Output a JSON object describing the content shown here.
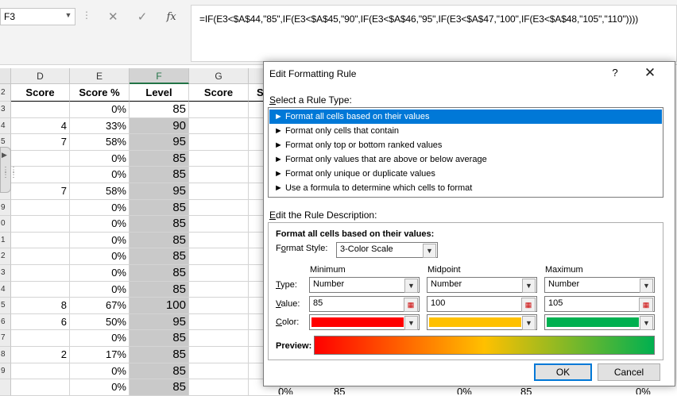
{
  "formula_bar": {
    "name_box": "F3",
    "cancel_glyph": "✕",
    "enter_glyph": "✓",
    "fx_label": "fx",
    "formula": "=IF(E3<$A$44,\"85\",IF(E3<$A$45,\"90\",IF(E3<$A$46,\"95\",IF(E3<$A$47,\"100\",IF(E3<$A$48,\"105\",\"110\"))))"
  },
  "sheet": {
    "columns": [
      "D",
      "E",
      "F",
      "G"
    ],
    "column_overflow": "",
    "selected_column": "F",
    "header_row_num": "2",
    "headers": {
      "D": "Score",
      "E": "Score %",
      "F": "Level",
      "G": "Score",
      "H": "S"
    },
    "row_numbers": [
      "3",
      "4",
      "5",
      "6",
      "7",
      "8",
      "9",
      "0",
      "1",
      "2",
      "3",
      "4",
      "5",
      "6",
      "7",
      "8",
      "9",
      ""
    ],
    "rows": [
      {
        "d": "",
        "e": "0%",
        "f": "85"
      },
      {
        "d": "4",
        "e": "33%",
        "f": "90"
      },
      {
        "d": "7",
        "e": "58%",
        "f": "95"
      },
      {
        "d": "",
        "e": "0%",
        "f": "85"
      },
      {
        "d": "",
        "e": "0%",
        "f": "85"
      },
      {
        "d": "7",
        "e": "58%",
        "f": "95"
      },
      {
        "d": "",
        "e": "0%",
        "f": "85"
      },
      {
        "d": "",
        "e": "0%",
        "f": "85"
      },
      {
        "d": "",
        "e": "0%",
        "f": "85"
      },
      {
        "d": "",
        "e": "0%",
        "f": "85"
      },
      {
        "d": "",
        "e": "0%",
        "f": "85"
      },
      {
        "d": "",
        "e": "0%",
        "f": "85"
      },
      {
        "d": "8",
        "e": "67%",
        "f": "100"
      },
      {
        "d": "6",
        "e": "50%",
        "f": "95"
      },
      {
        "d": "",
        "e": "0%",
        "f": "85"
      },
      {
        "d": "2",
        "e": "17%",
        "f": "85"
      },
      {
        "d": "",
        "e": "0%",
        "f": "85"
      },
      {
        "d": "",
        "e": "0%",
        "f": "85"
      }
    ],
    "below_dialog": [
      "0%",
      "85",
      "0%",
      "85",
      "0%"
    ]
  },
  "dialog": {
    "title": "Edit Formatting Rule",
    "help": "?",
    "close": "✕",
    "select_rule_type_label": "elect a Rule Type:",
    "select_rule_type_key": "S",
    "rule_types": [
      "► Format all cells based on their values",
      "► Format only cells that contain",
      "► Format only top or bottom ranked values",
      "► Format only values that are above or below average",
      "► Format only unique or duplicate values",
      "► Use a formula to determine which cells to format"
    ],
    "selected_rule_index": 0,
    "edit_desc_label": "dit the Rule Description:",
    "edit_desc_key": "E",
    "desc_heading": "Format all cells based on their values:",
    "format_style_label_key": "o",
    "format_style_label_pre": "F",
    "format_style_label_post": "rmat Style:",
    "format_style_value": "3-Color Scale",
    "col_min": "Minimum",
    "col_mid": "Midpoint",
    "col_max": "Maximum",
    "type_label_key": "T",
    "type_label_post": "ype:",
    "value_label_key": "V",
    "value_label_post": "alue:",
    "color_label_key": "C",
    "color_label_post": "olor:",
    "min_type": "Number",
    "mid_type": "Number",
    "max_type": "Number",
    "min_value": "85",
    "mid_value": "100",
    "max_value": "105",
    "min_color": "#ff0000",
    "mid_color": "#ffc000",
    "max_color": "#00b050",
    "preview_label": "Preview:",
    "ok": "OK",
    "cancel": "Cancel"
  }
}
